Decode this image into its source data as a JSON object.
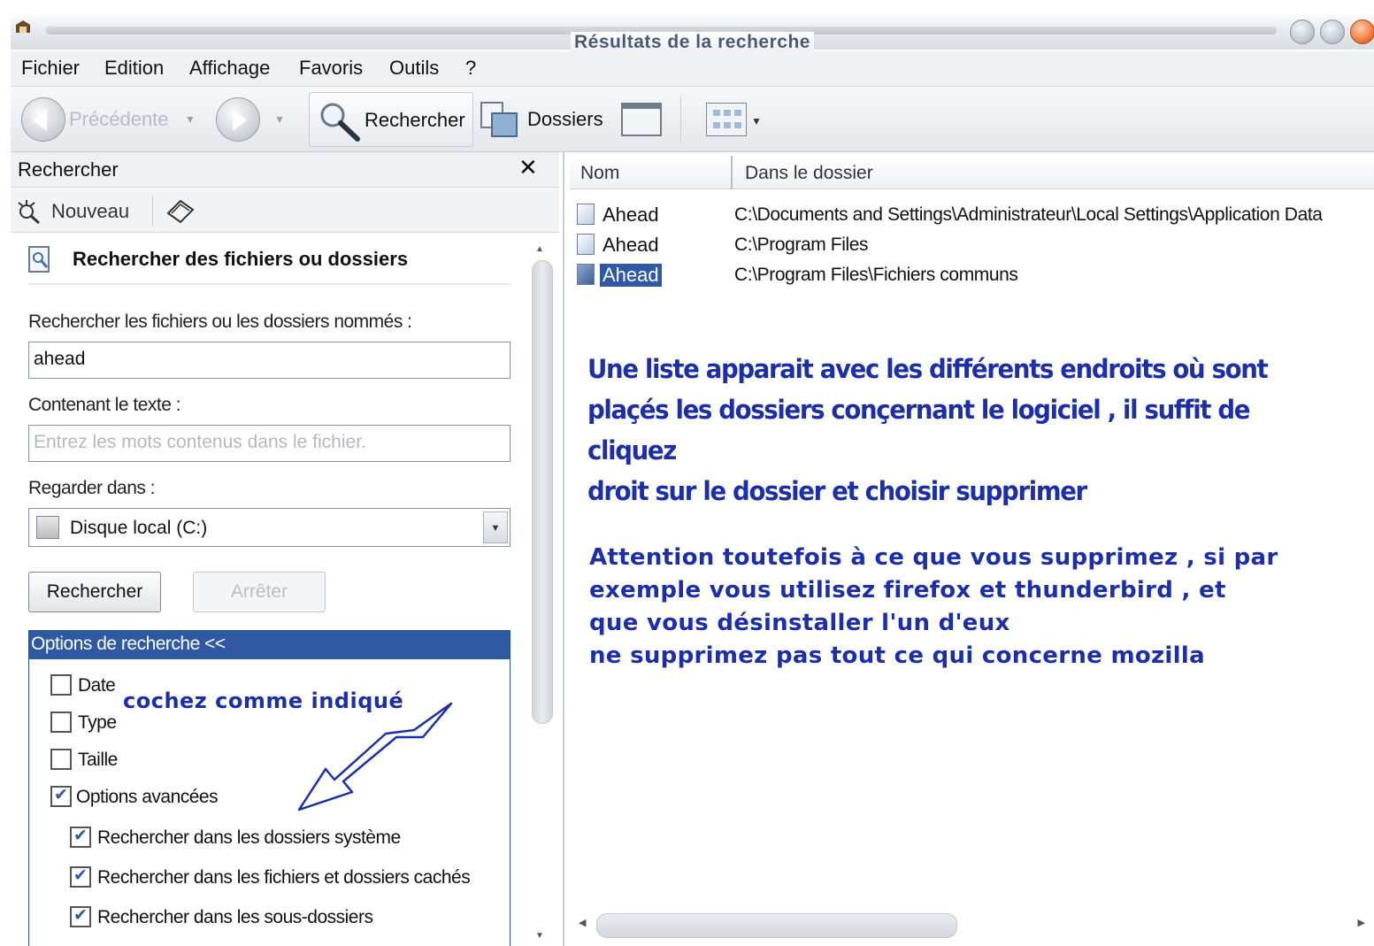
{
  "window": {
    "title": "Résultats de la recherche"
  },
  "menu": [
    "Fichier",
    "Edition",
    "Affichage",
    "Favoris",
    "Outils",
    "?"
  ],
  "toolbar": {
    "back_label": "Précédente",
    "search_label": "Rechercher",
    "folders_label": "Dossiers"
  },
  "left_pane": {
    "header": "Rechercher",
    "close_glyph": "✕",
    "new_label": "Nouveau",
    "panel_title": "Rechercher des fichiers ou dossiers",
    "name_label": "Rechercher les fichiers ou les dossiers nommés :",
    "name_value": "ahead",
    "text_label": "Contenant le texte :",
    "text_placeholder": "Entrez les mots contenus dans le fichier.",
    "look_in_label": "Regarder dans :",
    "look_in_value": "Disque local (C:)",
    "search_button": "Rechercher",
    "stop_button": "Arrêter",
    "options_header": "Options de recherche <<",
    "options": [
      {
        "label": "Date",
        "checked": false
      },
      {
        "label": "Type",
        "checked": false
      },
      {
        "label": "Taille",
        "checked": false
      },
      {
        "label": "Options avancées",
        "checked": true
      }
    ],
    "advanced": [
      {
        "label": "Rechercher dans les dossiers système",
        "checked": true
      },
      {
        "label": "Rechercher dans les fichiers et dossiers cachés",
        "checked": true
      },
      {
        "label": "Rechercher dans les sous-dossiers",
        "checked": true
      }
    ],
    "annotation": "cochez comme indiqué"
  },
  "results": {
    "columns": [
      "Nom",
      "Dans le dossier"
    ],
    "rows": [
      {
        "name": "Ahead",
        "folder": "C:\\Documents and Settings\\Administrateur\\Local Settings\\Application Data",
        "selected": false
      },
      {
        "name": "Ahead",
        "folder": "C:\\Program Files",
        "selected": false
      },
      {
        "name": "Ahead",
        "folder": "C:\\Program Files\\Fichiers communs",
        "selected": true
      }
    ],
    "annotation_1": [
      "Une liste apparait avec les différents endroits où sont",
      "plaçés les dossiers conçernant le logiciel , il suffit de cliquez",
      "droit sur le dossier et choisir supprimer"
    ],
    "annotation_2": [
      "Attention toutefois à ce que vous supprimez , si par",
      "exemple vous utilisez firefox et thunderbird , et",
      "que vous désinstaller l'un d'eux",
      "ne supprimez pas tout ce qui concerne mozilla"
    ]
  },
  "colors": {
    "accent": "#2f5aa3",
    "annotation": "#1d2fa8"
  }
}
